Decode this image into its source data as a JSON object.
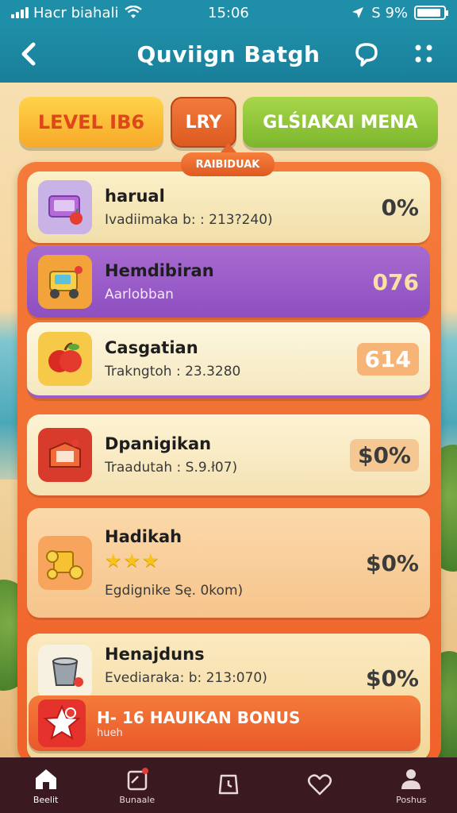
{
  "status_bar": {
    "carrier": "Hacr biahali",
    "time": "15:06",
    "battery_text": "S 9%",
    "battery_level": 0.9
  },
  "header": {
    "title": "Quviign Batgh",
    "icons": [
      "back-icon",
      "chat-icon",
      "more-icon"
    ]
  },
  "level_row": {
    "level_label": "LEVEL IB6",
    "lry_label": "LRY",
    "menu_label": "GLŚIAKAI MENA",
    "ribbon_label": "RAIBIDUAK"
  },
  "items": [
    {
      "name": "harual",
      "sub": "Ivadiimaka b: : 213?240)",
      "value": "0%",
      "icon": "cash-register-icon"
    },
    {
      "name": "Hemdibiran",
      "sub": "Aarlobban",
      "value": "076",
      "icon": "mower-icon"
    },
    {
      "name": "Casgatian",
      "sub": "Trakngtoh : 23.3280",
      "value": "614",
      "icon": "apple-icon"
    },
    {
      "name": "Dpanigikan",
      "sub": "Traadutah : S.9.ł07)",
      "value": "$0%",
      "icon": "crate-icon"
    },
    {
      "name": "Hadikah",
      "sub": "Egdignike Sę. 0kom)",
      "value": "$0%",
      "stars": "★★★",
      "icon": "coins-icon"
    },
    {
      "name": "Henajduns",
      "sub": "Evediaraka: b: 213:070)",
      "value": "$0%",
      "icon": "bucket-icon"
    }
  ],
  "bonus": {
    "title": "H- 16 HAUIKAN BONUS",
    "sub": "hueh",
    "icon": "bonus-star-icon"
  },
  "nav": [
    {
      "label": "Beelit",
      "icon": "home-icon"
    },
    {
      "label": "Bunaale",
      "icon": "notes-icon"
    },
    {
      "label": "",
      "icon": "clock-icon"
    },
    {
      "label": "",
      "icon": "heart-icon"
    },
    {
      "label": "Poshus",
      "icon": "profile-icon"
    }
  ],
  "colors": {
    "header": "#1f8ea8",
    "panel": "#f47b3a",
    "highlight_row": "#9a5cc6",
    "nav": "#3a1a20"
  }
}
